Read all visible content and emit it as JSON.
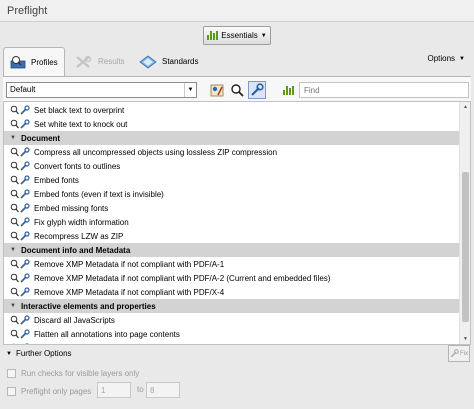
{
  "window": {
    "title": "Preflight"
  },
  "essentials": {
    "label": "Essentials"
  },
  "tabs": [
    {
      "label": "Profiles",
      "active": true
    },
    {
      "label": "Results",
      "active": false
    },
    {
      "label": "Standards",
      "active": false
    }
  ],
  "options": {
    "label": "Options"
  },
  "toolbar": {
    "profile_select": "Default",
    "find_placeholder": "Find"
  },
  "list": {
    "rows": [
      {
        "type": "item",
        "label": "Set black text to overprint"
      },
      {
        "type": "item",
        "label": "Set white text to knock out"
      },
      {
        "type": "group",
        "label": "Document"
      },
      {
        "type": "item",
        "label": "Compress all uncompressed objects using lossless ZIP compression"
      },
      {
        "type": "item",
        "label": "Convert fonts to outlines"
      },
      {
        "type": "item",
        "label": "Embed fonts"
      },
      {
        "type": "item",
        "label": "Embed fonts (even if text is invisible)"
      },
      {
        "type": "item",
        "label": "Embed missing fonts"
      },
      {
        "type": "item",
        "label": "Fix glyph width information"
      },
      {
        "type": "item",
        "label": "Recompress LZW as ZIP"
      },
      {
        "type": "group",
        "label": "Document info and Metadata"
      },
      {
        "type": "item",
        "label": "Remove XMP Metadata if not compliant with PDF/A-1"
      },
      {
        "type": "item",
        "label": "Remove XMP Metadata if not compliant with PDF/A-2 (Current and embedded files)"
      },
      {
        "type": "item",
        "label": "Remove XMP Metadata if not compliant with PDF/X-4"
      },
      {
        "type": "group",
        "label": "Interactive elements and properties"
      },
      {
        "type": "item",
        "label": "Discard all JavaScripts"
      },
      {
        "type": "item",
        "label": "Flatten all annotations into page contents"
      },
      {
        "type": "item",
        "label": "Flatten all form fields into page contents"
      }
    ]
  },
  "further_options": {
    "label": "Further Options",
    "fix_label": "Fix",
    "run_checks_label": "Run checks for visible layers only",
    "preflight_pages_label": "Preflight only pages",
    "page_from": "1",
    "to_label": "to",
    "page_to": "8"
  },
  "colors": {
    "group_bg": "#d3d3d3",
    "accent_green": "#5a9a1c",
    "selected_blue": "#d8e6f6"
  }
}
